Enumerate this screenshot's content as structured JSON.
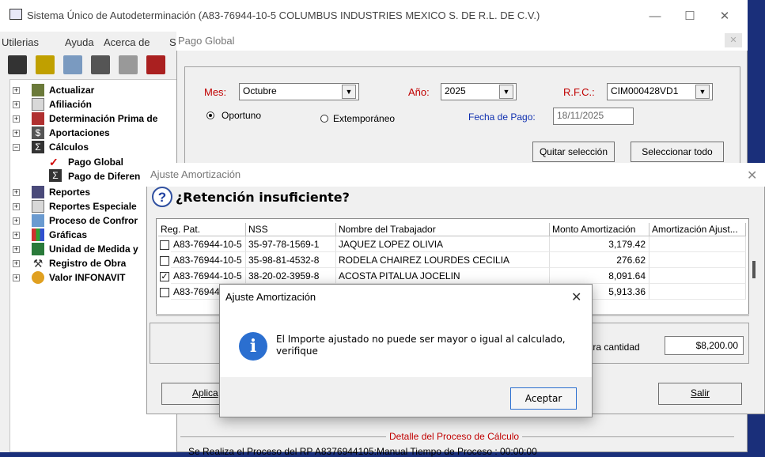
{
  "main_window": {
    "title": "Sistema Único de Autodeterminación (A83-76944-10-5  COLUMBUS INDUSTRIES MEXICO S. DE R.L. DE C.V.)",
    "menu": [
      "Utilerias",
      "Ayuda",
      "Acerca de",
      "S"
    ],
    "tree": [
      {
        "label": "Actualizar",
        "icon": "people-icon"
      },
      {
        "label": "Afiliación",
        "icon": "document-icon"
      },
      {
        "label": "Determinación Prima de",
        "icon": "chart-icon"
      },
      {
        "label": "Aportaciones",
        "icon": "dollar-icon"
      },
      {
        "label": "Cálculos",
        "icon": "sigma-icon"
      },
      {
        "label": "Pago Global",
        "icon": "checkmark-icon"
      },
      {
        "label": "Pago de Diferen",
        "icon": "sigma-icon"
      },
      {
        "label": "Reportes",
        "icon": "printer-icon"
      },
      {
        "label": "Reportes Especiale",
        "icon": "document-icon"
      },
      {
        "label": "Proceso de Confror",
        "icon": "folder-icon"
      },
      {
        "label": "Gráficas",
        "icon": "bar-chart-icon"
      },
      {
        "label": "Unidad de Medida y",
        "icon": "calculator-icon"
      },
      {
        "label": "Registro de Obra",
        "icon": "tools-icon"
      },
      {
        "label": "Valor INFONAVIT",
        "icon": "coin-icon"
      }
    ]
  },
  "pago_global": {
    "title": "Pago Global",
    "mes_label": "Mes:",
    "mes_value": "Octubre",
    "anio_label": "Año:",
    "anio_value": "2025",
    "rfc_label": "R.F.C.:",
    "rfc_value": "CIM000428VD1",
    "oportuno_label": "Oportuno",
    "extemporaneo_label": "Extemporáneo",
    "fecha_label": "Fecha de Pago:",
    "fecha_value": "18/11/2025",
    "quitar_label": "Quitar selección",
    "seleccionar_label": "Seleccionar todo",
    "detalle_label": "Detalle del Proceso de Cálculo",
    "detalle_text": "Se Realiza el Proceso del RP A8376944105:Manual   Tiempo de Proceso : 00:00:00"
  },
  "ajuste": {
    "title": "Ajuste Amortización",
    "heading": "¿Retención insuficiente?",
    "columns": [
      "Reg. Pat.",
      "NSS",
      "Nombre del Trabajador",
      "Monto Amortización",
      "Amortización Ajust..."
    ],
    "rows": [
      {
        "checked": false,
        "reg": "A83-76944-10-5",
        "nss": "35-97-78-1569-1",
        "nombre": "JAQUEZ LOPEZ OLIVIA",
        "monto": "3,179.42"
      },
      {
        "checked": false,
        "reg": "A83-76944-10-5",
        "nss": "35-98-81-4532-8",
        "nombre": "RODELA CHAIREZ LOURDES CECILIA",
        "monto": "276.62"
      },
      {
        "checked": true,
        "reg": "A83-76944-10-5",
        "nss": "38-20-02-3959-8",
        "nombre": "ACOSTA PITALUA JOCELIN",
        "monto": "8,091.64"
      },
      {
        "checked": false,
        "reg": "A83-76944",
        "nss": "",
        "nombre": "",
        "monto": "5,913.36"
      }
    ],
    "otra_label": "tra cantidad",
    "otra_value": "$8,200.00",
    "aplicar_label": "Aplica",
    "salir_label": "Salir"
  },
  "message": {
    "title": "Ajuste Amortización",
    "text": "El Importe ajustado no puede ser mayor o igual al calculado, verifique",
    "ok_label": "Aceptar"
  }
}
